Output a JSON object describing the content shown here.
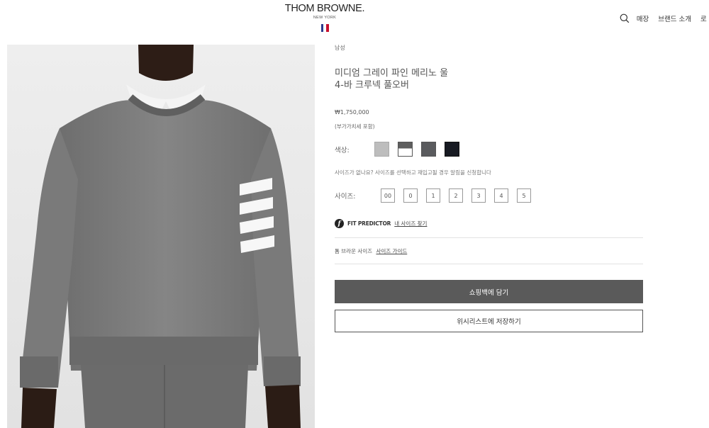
{
  "header": {
    "logo_brand": "THOM BROWNE.",
    "logo_city": "NEW YORK",
    "nav": [
      {
        "label": "매장"
      },
      {
        "label": "브랜드 소개"
      },
      {
        "label": "로"
      }
    ],
    "flag_colors": [
      "#2a3a8c",
      "#ffffff",
      "#c8102e"
    ]
  },
  "product": {
    "breadcrumb": "남성",
    "title_line1": "미디엄 그레이 파인 메리노 울",
    "title_line2": "4-바 크루넥 풀오버",
    "price": "₩1,750,000",
    "vat_note": "(부가가치세 포함)",
    "color_label": "색상:",
    "colors": [
      "light-gray",
      "gray-white",
      "dark-gray",
      "navy"
    ],
    "size_note": "사이즈가 없나요? 사이즈를 선택하고 재입고될 경우 알림을 신청합니다",
    "size_label": "사이즈:",
    "sizes": [
      "00",
      "0",
      "1",
      "2",
      "3",
      "4",
      "5"
    ],
    "fit_predictor": "FIT PREDICTOR",
    "fit_link": "내 사이즈 찾기",
    "guide_prefix": "톰 브라운 사이즈",
    "guide_link": "사이즈 가이드",
    "add_to_bag": "쇼핑백에 담기",
    "wishlist": "위시리스트에 저장하기"
  }
}
